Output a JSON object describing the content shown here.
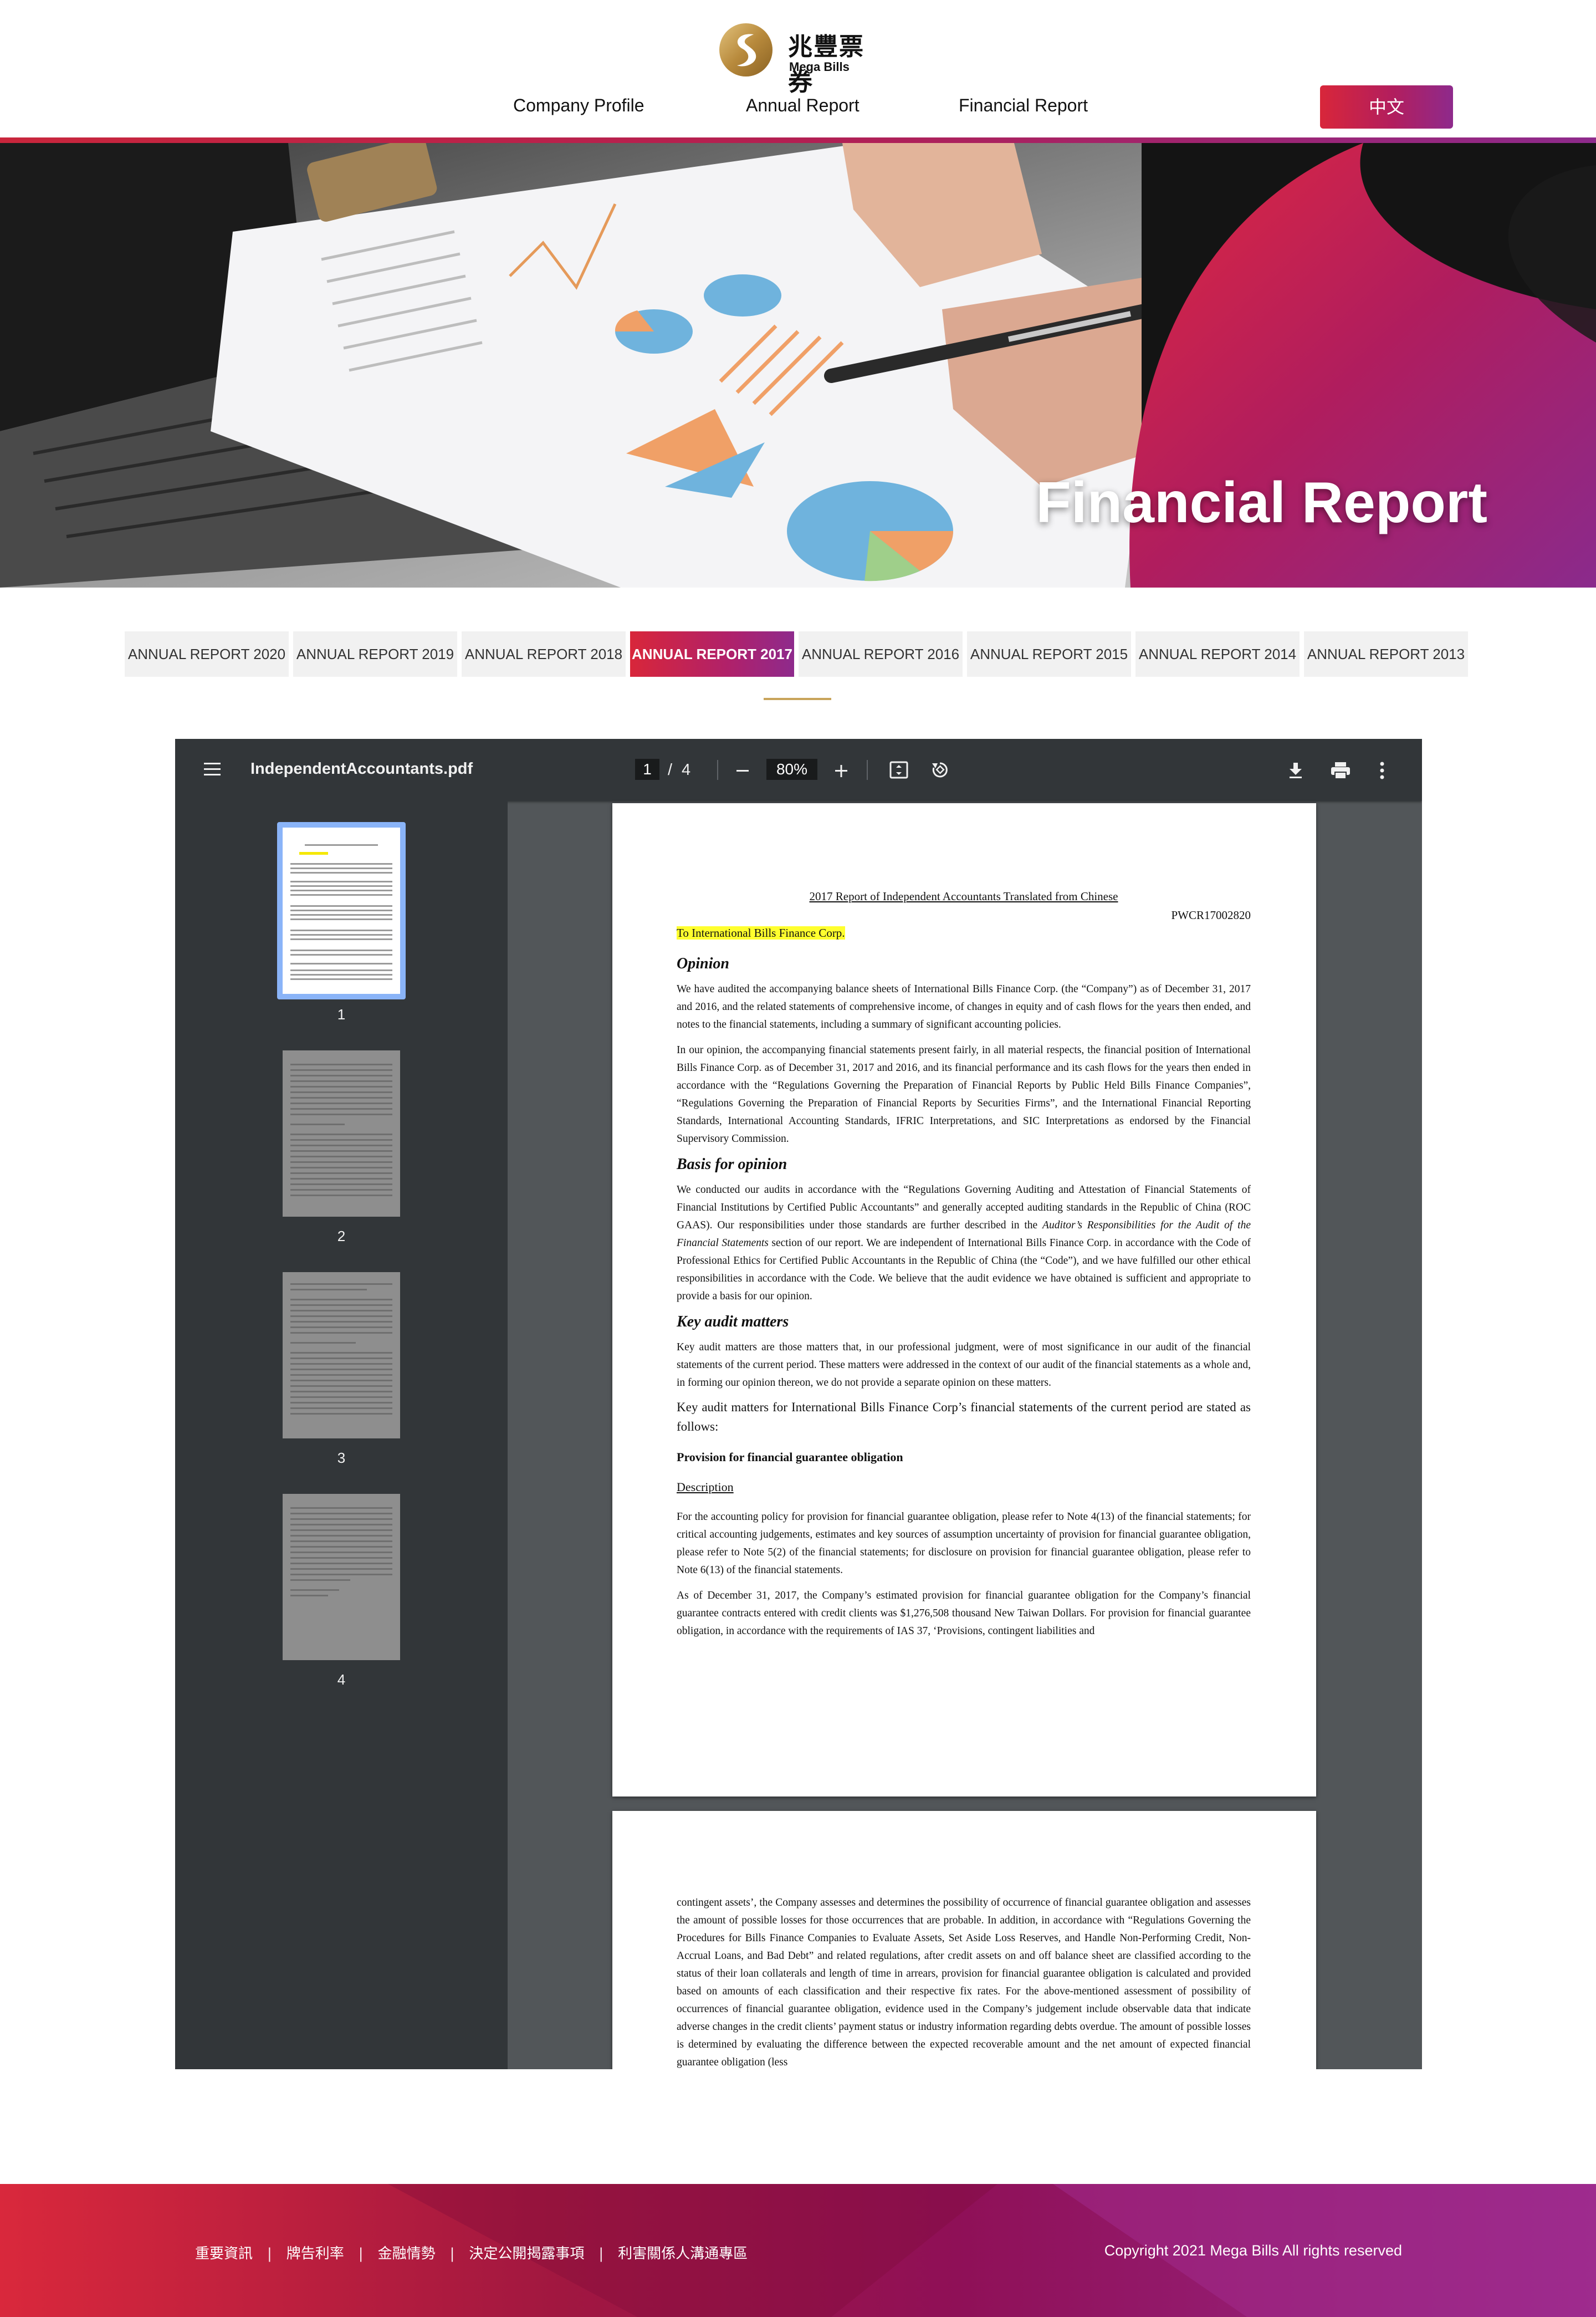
{
  "header": {
    "logo_zh": "兆豐票券",
    "logo_en": "Mega Bills",
    "nav": [
      "Company Profile",
      "Annual Report",
      "Financial Report"
    ],
    "lang_button": "中文"
  },
  "hero": {
    "title": "Financial Report"
  },
  "tabs": {
    "items": [
      "ANNUAL REPORT 2020",
      "ANNUAL REPORT 2019",
      "ANNUAL REPORT 2018",
      "ANNUAL REPORT 2017",
      "ANNUAL REPORT 2016",
      "ANNUAL REPORT 2015",
      "ANNUAL REPORT 2014",
      "ANNUAL REPORT 2013"
    ],
    "active": "ANNUAL REPORT 2017"
  },
  "viewer": {
    "filename": "IndependentAccountants.pdf",
    "current_page": "1",
    "page_sep": "/",
    "total_pages": "4",
    "zoom": "80%",
    "thumbnails": [
      "1",
      "2",
      "3",
      "4"
    ],
    "icons": [
      "menu-icon",
      "zoom-out-icon",
      "zoom-in-icon",
      "fit-page-icon",
      "rotate-icon",
      "download-icon",
      "print-icon",
      "more-icon"
    ]
  },
  "document": {
    "title": "2017 Report of Independent Accountants Translated from Chinese",
    "ref": "PWCR17002820",
    "addressee": "To International Bills Finance Corp.",
    "opinion_heading": "Opinion",
    "opinion_p1": "We have audited the accompanying balance sheets of International Bills Finance Corp. (the “Company”) as of December 31, 2017 and 2016, and the related statements of comprehensive income, of changes in equity and of cash flows for the years then ended, and notes to the financial statements, including a summary of significant accounting policies.",
    "opinion_p2": "In our opinion, the accompanying financial statements present fairly, in all material respects, the financial position of International Bills Finance Corp. as of December 31, 2017 and 2016, and its financial performance and its cash flows for the years then ended in accordance with the “Regulations Governing the Preparation of Financial Reports by Public Held Bills Finance Companies”, “Regulations Governing the Preparation of Financial Reports by Securities Firms”, and the International Financial Reporting Standards, International Accounting Standards, IFRIC Interpretations, and SIC Interpretations as endorsed by the Financial Supervisory Commission.",
    "basis_heading": "Basis for opinion",
    "basis_p1": "We conducted our audits in accordance with the “Regulations Governing Auditing and Attestation of Financial Statements of Financial Institutions by Certified Public Accountants” and generally accepted auditing standards in the Republic of China (ROC GAAS). Our responsibilities under those standards are further described in the ",
    "basis_p1_italic": "Auditor’s Responsibilities for the Audit of the Financial Statements",
    "basis_p1_rest": " section of our report. We are independent of International Bills Finance Corp. in accordance with the Code of Professional Ethics for Certified Public Accountants in the Republic of China (the “Code”), and we have fulfilled our other ethical responsibilities in accordance with the Code. We believe that the audit evidence we have obtained is sufficient and appropriate to provide a basis for our opinion.",
    "kam_heading": "Key audit matters",
    "kam_p1": "Key audit matters are those matters that, in our professional judgment, were of most significance in our audit of the financial statements of the current period. These matters were addressed in the context of our audit of the financial statements as a whole and, in forming our opinion thereon, we do not provide a separate opinion on these matters.",
    "kam_p2": "Key audit matters for International Bills Finance Corp’s financial statements of the current period are stated as follows:",
    "provision_heading": "Provision for financial guarantee obligation",
    "description_heading": "Description",
    "desc_p1": "For the accounting policy for provision for financial guarantee obligation, please refer to Note 4(13) of the financial statements; for critical accounting judgements, estimates and key sources of assumption uncertainty of provision for financial guarantee obligation, please refer to Note 5(2) of the financial statements; for disclosure on provision for financial guarantee obligation, please refer to Note 6(13) of the financial statements.",
    "desc_p2": "As of December 31, 2017, the Company’s estimated provision for financial guarantee obligation for the Company’s financial guarantee contracts entered with credit clients was $1,276,508 thousand New Taiwan Dollars. For provision for financial guarantee obligation, in accordance with the requirements of IAS 37, ‘Provisions, contingent liabilities and",
    "page2_p1": "contingent assets’, the Company assesses and determines the possibility of occurrence of financial guarantee obligation and assesses the amount of possible losses for those occurrences that are probable. In addition, in accordance with “Regulations Governing the Procedures for Bills Finance Companies to Evaluate Assets, Set Aside Loss Reserves, and Handle Non-Performing Credit, Non-Accrual Loans, and Bad Debt” and related regulations, after credit assets on and off balance sheet are classified according to the status of their loan collaterals and length of time in arrears, provision for financial guarantee obligation is calculated and provided based on amounts of each classification and their respective fix rates. For the above-mentioned assessment of possibility of occurrences of financial guarantee obligation, evidence used in the Company’s judgement include observable data that indicate adverse changes in the credit clients’ payment status or industry information regarding debts overdue. The amount of possible losses is determined by evaluating the difference between the expected recoverable amount and the net amount of expected financial guarantee obligation (less"
  },
  "footer": {
    "links": [
      "重要資訊",
      "牌告利率",
      "金融情勢",
      "決定公開揭露事項",
      "利害關係人溝通專區"
    ],
    "separator": "|",
    "copyright": "Copyright 2021 Mega Bills All rights reserved"
  },
  "colors": {
    "brand_red": "#d8263a",
    "brand_purple": "#8e2a8c",
    "gold": "#c8a45a",
    "viewer_toolbar": "#323639",
    "viewer_bg": "#525659",
    "thumb_selected": "#8ab4f8"
  }
}
